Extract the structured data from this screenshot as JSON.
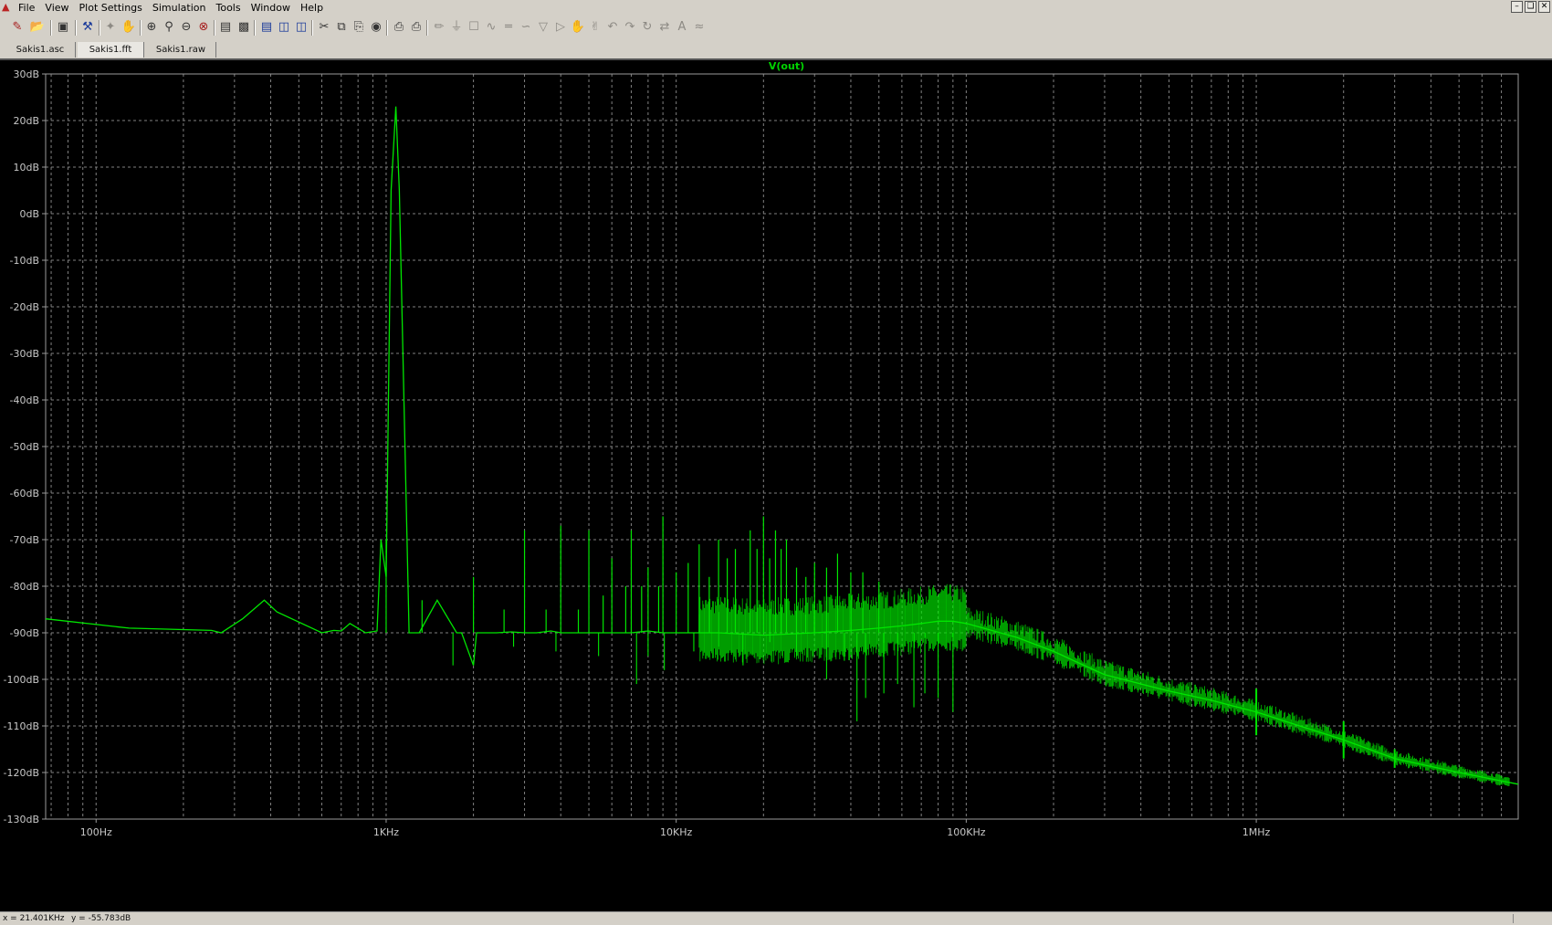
{
  "menubar": {
    "items": [
      "File",
      "View",
      "Plot Settings",
      "Simulation",
      "Tools",
      "Window",
      "Help"
    ],
    "app_icon": "ltspice-app-icon",
    "window_buttons": [
      "minimize-icon",
      "restore-icon",
      "close-icon"
    ]
  },
  "toolbar": {
    "icons": [
      "new-schematic-icon",
      "open-icon",
      "save-icon",
      "control-panel-icon",
      "run-icon",
      "halt-icon",
      "zoom-in-icon",
      "zoom-pan-icon",
      "zoom-out-icon",
      "zoom-fit-icon",
      "autorange-icon",
      "mark-icon",
      "tile-horizontal-icon",
      "tile-vertical-icon",
      "cascade-icon",
      "cut-icon",
      "copy-icon",
      "paste-icon",
      "find-icon",
      "print-setup-icon",
      "print-icon",
      "wire-icon",
      "ground-icon",
      "label-icon",
      "resistor-icon",
      "capacitor-icon",
      "inductor-icon",
      "diode-icon",
      "component-icon",
      "move-icon",
      "drag-icon",
      "undo-icon",
      "redo-icon",
      "rotate-icon",
      "mirror-icon",
      "text-icon",
      "spice-directive-icon"
    ]
  },
  "tabs": [
    {
      "label": "Sakis1.asc",
      "active": false
    },
    {
      "label": "Sakis1.fft",
      "active": true
    },
    {
      "label": "Sakis1.raw",
      "active": false
    }
  ],
  "chart_data": {
    "type": "line",
    "title": "V(out)",
    "xlabel": "",
    "ylabel": "",
    "x_scale": "log",
    "xlim": [
      67,
      8000000
    ],
    "ylim": [
      -130,
      30
    ],
    "grid": true,
    "background": "#000000",
    "trace_color": "#00e600",
    "grid_color": "#808080",
    "y_ticks": [
      "30dB",
      "20dB",
      "10dB",
      "0dB",
      "-10dB",
      "-20dB",
      "-30dB",
      "-40dB",
      "-50dB",
      "-60dB",
      "-70dB",
      "-80dB",
      "-90dB",
      "-100dB",
      "-110dB",
      "-120dB",
      "-130dB"
    ],
    "y_tick_values": [
      30,
      20,
      10,
      0,
      -10,
      -20,
      -30,
      -40,
      -50,
      -60,
      -70,
      -80,
      -90,
      -100,
      -110,
      -120,
      -130
    ],
    "x_ticks": [
      "100Hz",
      "1KHz",
      "10KHz",
      "100KHz",
      "1MHz"
    ],
    "x_tick_values": [
      100,
      1000,
      10000,
      100000,
      1000000
    ],
    "series": [
      {
        "name": "V(out)",
        "x": [
          67,
          130,
          250,
          270,
          320,
          380,
          420,
          600,
          660,
          700,
          750,
          850,
          930,
          960,
          1000,
          1040,
          1080,
          1110,
          1200,
          1300,
          1500,
          1750,
          1820,
          2000,
          2050,
          2200,
          2400,
          2700,
          3000,
          3080,
          3300,
          3700,
          4000,
          4500,
          5000,
          6000,
          7000,
          8000,
          9000,
          10000,
          14000,
          20000,
          30000,
          40000,
          50000,
          60000,
          70000,
          80000,
          90000,
          100000,
          150000,
          200000,
          300000,
          500000,
          700000,
          1000000,
          1500000,
          2000000,
          3000000,
          5000000,
          8000000
        ],
        "y": [
          -87,
          -89,
          -89.5,
          -90,
          -87,
          -83,
          -85.5,
          -90,
          -89.5,
          -89.6,
          -88,
          -90,
          -89.6,
          -70,
          -78,
          5,
          23,
          5,
          -90,
          -90,
          -83,
          -90,
          -90,
          -97,
          -90,
          -90,
          -90,
          -89.8,
          -90,
          -90,
          -90,
          -89.6,
          -90,
          -90,
          -90,
          -90,
          -90,
          -89.6,
          -90,
          -90,
          -90,
          -90.5,
          -90,
          -89.5,
          -89,
          -88.5,
          -88,
          -87.5,
          -87.5,
          -88,
          -91,
          -94,
          -99,
          -102.5,
          -104.5,
          -107,
          -110.5,
          -113,
          -117,
          -120,
          -122.5
        ]
      }
    ],
    "spurs": {
      "x": [
        1000,
        1330,
        2000,
        2550,
        3000,
        3560,
        4000,
        4600,
        5000,
        5600,
        6000,
        6700,
        7000,
        7600,
        8000,
        8700,
        9000,
        10000,
        11000,
        12000,
        13000,
        14000,
        15000,
        16000,
        18000,
        19000,
        20000,
        21000,
        22000,
        23000,
        24000,
        26000,
        28000,
        30000,
        33000,
        36000,
        40000,
        44000,
        50000
      ],
      "y": [
        -70,
        -83,
        -78,
        -85,
        -68,
        -85,
        -67,
        -85,
        -68,
        -82,
        -74,
        -80,
        -68,
        -80,
        -76,
        -80,
        -65,
        -77,
        -75,
        -71,
        -78,
        -70,
        -74,
        -72,
        -68,
        -72,
        -65,
        -74,
        -68,
        -72,
        -70,
        -76,
        -78,
        -75,
        -76,
        -73,
        -77,
        -77,
        -79
      ]
    },
    "dips": {
      "x": [
        1700,
        2750,
        3850,
        5400,
        7300,
        8000,
        9100,
        11500,
        14000,
        17000,
        21000,
        26000,
        33000,
        38000,
        42000,
        45000,
        52000,
        58000,
        66000,
        72000,
        80000,
        90000
      ],
      "y": [
        -97,
        -93,
        -94,
        -95,
        -101,
        -95,
        -98,
        -94,
        -93,
        -97,
        -92,
        -95,
        -100,
        -96,
        -109,
        -104,
        -103,
        -101,
        -106,
        -103,
        -104,
        -107
      ]
    },
    "markers": {
      "x": [
        1000000,
        2000000,
        3000000
      ],
      "y": [
        -107,
        -113,
        -117
      ],
      "half_height_db": [
        5,
        4,
        2
      ]
    }
  },
  "statusbar": {
    "x_readout": "x = 21.401KHz",
    "y_readout": "y = -55.783dB"
  }
}
